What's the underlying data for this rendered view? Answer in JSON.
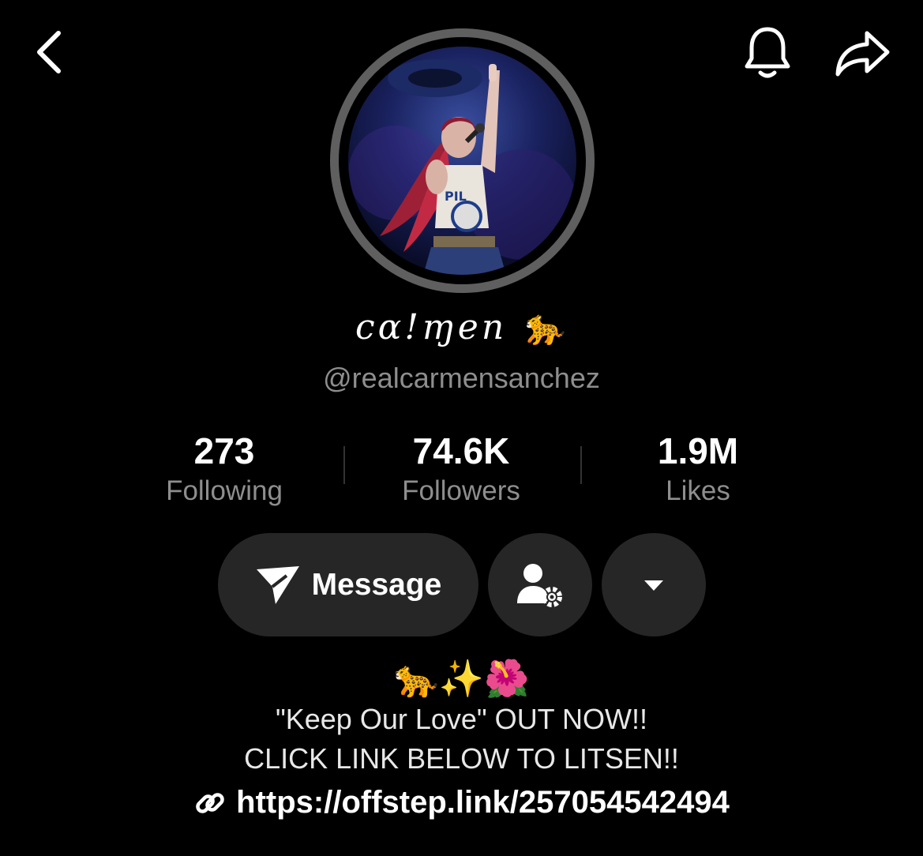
{
  "profile": {
    "display_name": "cα!ɱen 🐆",
    "handle": "@realcarmensanchez"
  },
  "stats": {
    "following": {
      "count": "273",
      "label": "Following"
    },
    "followers": {
      "count": "74.6K",
      "label": "Followers"
    },
    "likes": {
      "count": "1.9M",
      "label": "Likes"
    }
  },
  "actions": {
    "message_label": "Message"
  },
  "bio": {
    "emoji_line": "🐆✨🌺",
    "line1": "\"Keep Our Love\" OUT NOW!!",
    "line2": "CLICK LINK BELOW TO LITSEN!!",
    "link": "https://offstep.link/257054542494"
  },
  "icons": {
    "back": "chevron-left-icon",
    "notifications": "bell-icon",
    "share": "share-arrow-icon",
    "message": "paper-plane-icon",
    "friend_settings": "person-gear-icon",
    "more": "caret-down-icon",
    "link": "link-chain-icon"
  },
  "colors": {
    "background": "#000000",
    "button": "#262626",
    "secondary_text": "#8e8e8e",
    "avatar_ring": "#5f5f5f"
  }
}
